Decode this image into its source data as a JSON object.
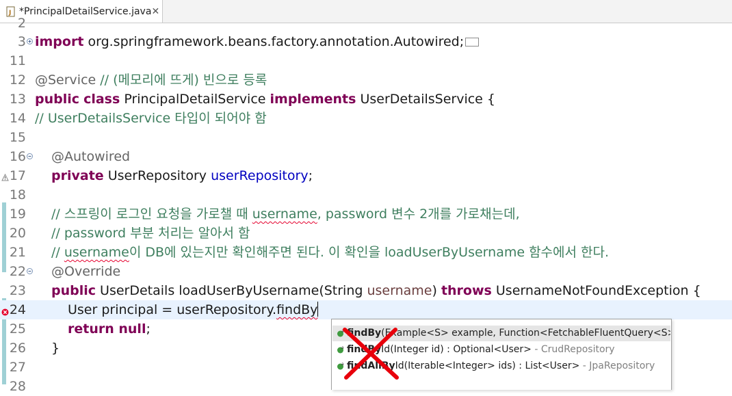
{
  "tab": {
    "title": "*PrincipalDetailService.java",
    "close": "✕",
    "icon": "java-file-icon"
  },
  "editor": {
    "lines": [
      {
        "no": "2",
        "text": ""
      },
      {
        "no": "3",
        "import_kw": "import",
        "import_path": " org.springframework.beans.factory.annotation.Autowired;"
      },
      {
        "no": "11",
        "text": ""
      },
      {
        "no": "12",
        "annotation": "@Service",
        "comment": " // (메모리에 뜨게) 빈으로 등록"
      },
      {
        "no": "13",
        "kw1": "public",
        "kw2": "class",
        "class_name": " PrincipalDetailService ",
        "kw3": "implements",
        "iface": " UserDetailsService {"
      },
      {
        "no": "14",
        "comment": "// UserDetailsService 타입이 되어야 함"
      },
      {
        "no": "15",
        "text": ""
      },
      {
        "no": "16",
        "annotation": "@Autowired"
      },
      {
        "no": "17",
        "kw": "private",
        "type": " UserRepository ",
        "field": "userRepository",
        "semi": ";"
      },
      {
        "no": "18",
        "text": ""
      },
      {
        "no": "19",
        "comment_a": "// 스프링이 로그인 요청을 가로챌 때 ",
        "comment_u": "username",
        "comment_b": ", password 변수 2개를 가로채는데,"
      },
      {
        "no": "20",
        "comment": "// password 부분 처리는 알아서 함"
      },
      {
        "no": "21",
        "comment_a": "// ",
        "comment_u": "username",
        "comment_b": "이 DB에 있는지만 확인해주면 된다. 이 확인을 loadUserByUsername 함수에서 한다."
      },
      {
        "no": "22",
        "annotation": "@Override"
      },
      {
        "no": "23",
        "kw1": "public",
        "sig_a": " UserDetails loadUserByUsername(String ",
        "param": "username",
        "sig_b": ") ",
        "kw2": "throws",
        "sig_c": " UsernameNotFoundException {"
      },
      {
        "no": "24",
        "code_a": "User principal = userRepository.",
        "code_err": "findBy"
      },
      {
        "no": "25",
        "kw1": "return",
        "kw2": " null",
        "semi": ";"
      },
      {
        "no": "26",
        "text": "}"
      },
      {
        "no": "27",
        "text": ""
      },
      {
        "no": "28",
        "text": ""
      }
    ]
  },
  "content_assist": {
    "proposals": [
      {
        "name": "findBy",
        "rest": "(Example<S> example, Function<FetchableFluentQuery<S>,R>",
        "decl": ""
      },
      {
        "name": "findBy",
        "rest": "Id(Integer id) : Optional<User>",
        "decl": " - CrudRepository"
      },
      {
        "name": "findAllBy",
        "rest": "Id(Iterable<Integer> ids) : List<User>",
        "decl": " - JpaRepository"
      }
    ]
  },
  "colors": {
    "keyword": "#7f0055",
    "comment": "#3f7f5f",
    "field": "#0000c0",
    "annotation": "#646464",
    "current_line": "#e8f2fe",
    "error": "#e5002c"
  }
}
